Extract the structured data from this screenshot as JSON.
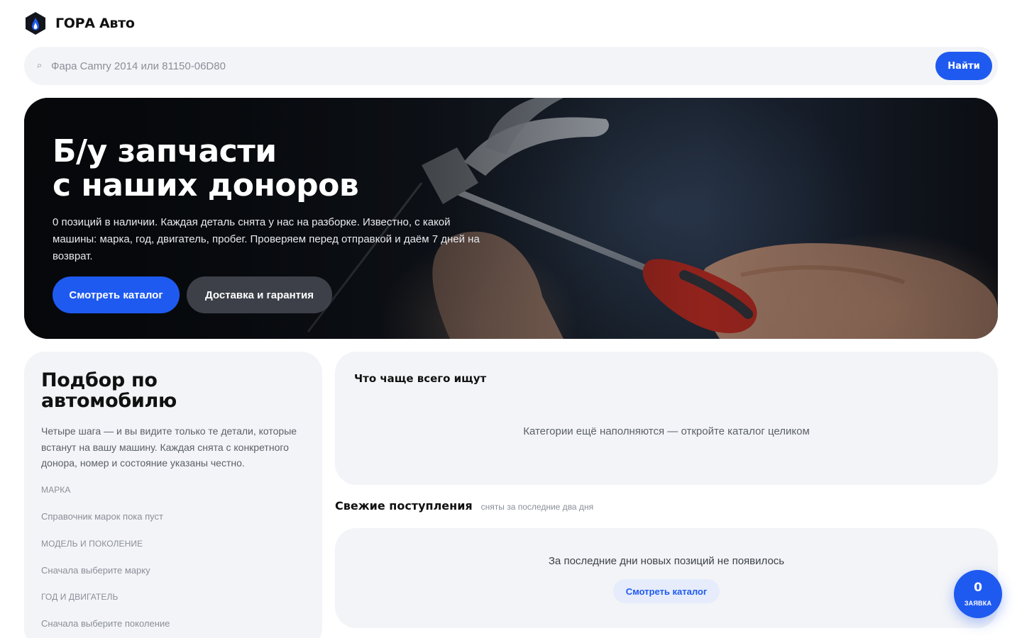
{
  "brand": {
    "name": "ГОРА Авто",
    "logo_icon": "hexagon-flame-logo",
    "accent": "#1f5af0"
  },
  "search": {
    "icon": "search-icon",
    "placeholder": "Фара Camry 2014 или 81150-06D80",
    "value": "",
    "button_label": "Найти"
  },
  "hero": {
    "title_line1": "Б/у запчасти",
    "title_line2": "с наших доноров",
    "description": "0 позиций в наличии. Каждая деталь снята у нас на разборке. Известно, с какой машины: марка, год, двигатель, пробег. Проверяем перед отправкой и даём 7 дней на возврат.",
    "primary_button": "Смотреть каталог",
    "secondary_button": "Доставка и гарантия"
  },
  "picker": {
    "title_line1": "Подбор по",
    "title_line2": "автомобилю",
    "description": "Четыре шага — и вы видите только те детали, которые встанут на вашу машину. Каждая снята с конкретного донора, номер и состояние указаны честно.",
    "steps": [
      {
        "label": "МАРКА",
        "hint": "Справочник марок пока пуст"
      },
      {
        "label": "МОДЕЛЬ И ПОКОЛЕНИЕ",
        "hint": "Сначала выберите марку"
      },
      {
        "label": "ГОД И ДВИГАТЕЛЬ",
        "hint": "Сначала выберите поколение"
      }
    ]
  },
  "popular": {
    "title": "Что чаще всего ищут",
    "empty_text": "Категории ещё наполняются — откройте каталог целиком"
  },
  "fresh": {
    "title": "Свежие поступления",
    "subtitle": "сняты за последние два дня",
    "empty_text": "За последние дни новых позиций не появилось",
    "button_label": "Смотреть каталог"
  },
  "fab": {
    "count": "0",
    "label": "ЗАЯВКА"
  }
}
